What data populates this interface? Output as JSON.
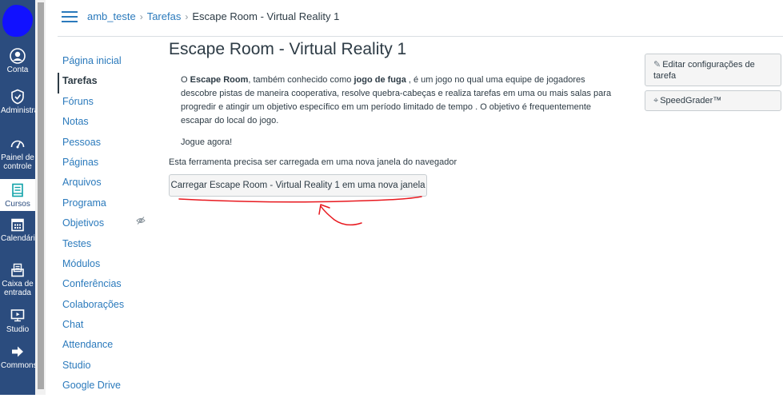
{
  "global_nav": {
    "items": [
      {
        "label": "Conta",
        "icon": "account-icon"
      },
      {
        "label": "Administrador",
        "icon": "admin-icon"
      },
      {
        "label": "Painel de controle",
        "icon": "dashboard-icon"
      },
      {
        "label": "Cursos",
        "icon": "courses-icon"
      },
      {
        "label": "Calendário",
        "icon": "calendar-icon"
      },
      {
        "label": "Caixa de entrada",
        "icon": "inbox-icon"
      },
      {
        "label": "Studio",
        "icon": "studio-icon"
      },
      {
        "label": "Commons",
        "icon": "commons-icon"
      }
    ],
    "active_item": "Cursos",
    "colors": {
      "background": "#2b4c7e",
      "active_background": "#ffffff"
    }
  },
  "breadcrumb": {
    "course": "amb_teste",
    "section": "Tarefas",
    "current": "Escape Room - Virtual Reality 1",
    "separator": "›"
  },
  "course_nav": {
    "items": [
      {
        "label": "Página inicial"
      },
      {
        "label": "Tarefas",
        "active": true
      },
      {
        "label": "Fóruns"
      },
      {
        "label": "Notas"
      },
      {
        "label": "Pessoas"
      },
      {
        "label": "Páginas"
      },
      {
        "label": "Arquivos"
      },
      {
        "label": "Programa"
      },
      {
        "label": "Objetivos",
        "hidden_icon": "eye-off-icon"
      },
      {
        "label": "Testes"
      },
      {
        "label": "Módulos"
      },
      {
        "label": "Conferências"
      },
      {
        "label": "Colaborações"
      },
      {
        "label": "Chat"
      },
      {
        "label": "Attendance"
      },
      {
        "label": "Studio"
      },
      {
        "label": "Google Drive"
      }
    ]
  },
  "main": {
    "title": "Escape Room - Virtual Reality 1",
    "description": {
      "part1": "O ",
      "bold1": "Escape Room",
      "part2": ", também conhecido como ",
      "bold2": "jogo de fuga",
      "part3": " , é um jogo no qual uma equipe de jogadores descobre pistas de maneira cooperativa, resolve quebra-cabeças e realiza tarefas em uma ou mais salas para progredir e atingir um objetivo específico em um período limitado de tempo . O objetivo é frequentemente escapar do local do jogo.",
      "cta": "Jogue agora!"
    },
    "notice": "Esta ferramenta precisa ser carregada em uma nova janela do navegador",
    "load_button": "Carregar Escape Room - Virtual Reality 1 em uma nova janela",
    "annotation_color": "#e8191f"
  },
  "sidebar": {
    "edit_button": "Editar configurações de tarefa",
    "edit_icon": "pencil-icon",
    "speedgrader_button": "SpeedGrader™",
    "speedgrader_icon": "speedgrader-icon"
  }
}
